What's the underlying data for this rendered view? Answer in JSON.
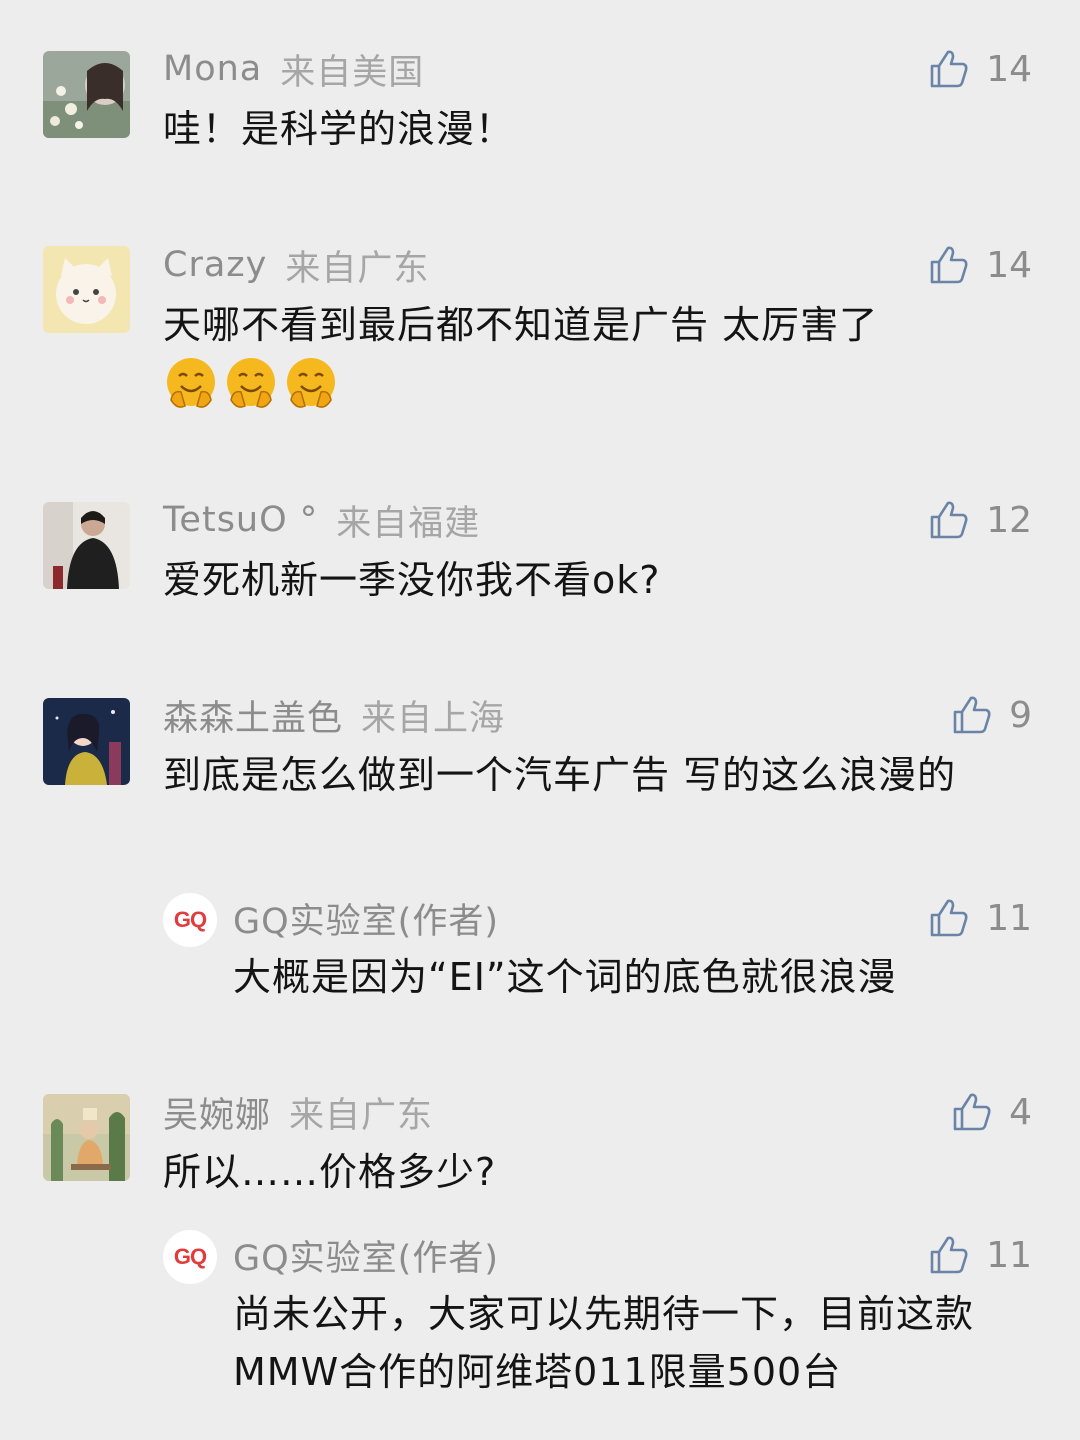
{
  "comments": [
    {
      "name": "Mona",
      "location": "来自美国",
      "likes": "14",
      "text": "哇！是科学的浪漫！",
      "avatar_icon": "girl-flowers-avatar"
    },
    {
      "name": "Crazy",
      "location": "来自广东",
      "likes": "14",
      "text": "天哪不看到最后都不知道是广告 太厉害了",
      "emojis": [
        "hug-emoji",
        "hug-emoji",
        "hug-emoji"
      ],
      "avatar_icon": "cat-avatar"
    },
    {
      "name": "TetsuO °",
      "location": "来自福建",
      "likes": "12",
      "text": "爱死机新一季没你我不看ok?",
      "avatar_icon": "person-dark-avatar"
    },
    {
      "name": "森森土盖色",
      "location": "来自上海",
      "likes": "9",
      "text": "到底是怎么做到一个汽车广告 写的这么浪漫的",
      "avatar_icon": "anime-girl-avatar",
      "reply": {
        "name": "GQ实验室(作者)",
        "logo": "GQ",
        "likes": "11",
        "text": "大概是因为“EI”这个词的底色就很浪漫"
      }
    },
    {
      "name": "吴婉娜",
      "location": "来自广东",
      "likes": "4",
      "text": "所以……价格多少?",
      "avatar_icon": "illustrated-room-avatar",
      "reply": {
        "name": "GQ实验室(作者)",
        "logo": "GQ",
        "likes": "11",
        "text": "尚未公开，大家可以先期待一下，目前这款MMW合作的阿维塔011限量500台"
      }
    }
  ],
  "colors": {
    "background": "#ededed",
    "name": "#8c8c8c",
    "location": "#a6a6a6",
    "text": "#141414",
    "like_icon": "#6a84a8",
    "gq_red": "#e23b3b"
  }
}
